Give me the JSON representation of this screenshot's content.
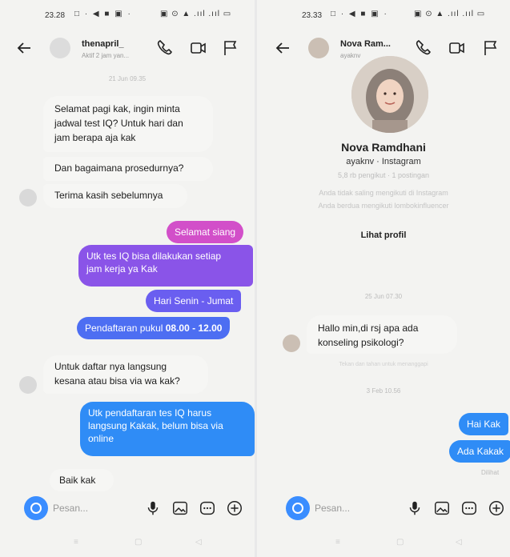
{
  "left": {
    "status": {
      "time": "23.28",
      "left_icons": "□ · ◀ ■ ▣ ·",
      "right_icons": "▣ ⊙ ▲ .ııl .ııl ▭"
    },
    "header": {
      "name": "thenapril_",
      "subtitle": "Aktif 2 jam yan..."
    },
    "timestamp_top": "21 Jun 09.35",
    "messages_in_top": [
      "Selamat pagi kak, ingin minta",
      "jadwal test IQ? Untuk hari dan",
      "jam berapa aja kak",
      "Dan bagaimana prosedurnya?",
      "Terima kasih sebelumnya"
    ],
    "messages_out": {
      "m1": "Selamat siang",
      "m2_line1": "Utk tes IQ bisa dilakukan setiap",
      "m2_line2": "jam kerja ya Kak",
      "m3": "Hari Senin - Jumat",
      "m4_prefix": "Pendaftaran pukul ",
      "m4_bold": "08.00 - 12.00",
      "m5_line1": "Utk pendaftaran tes IQ harus",
      "m5_line2": "langsung Kakak, belum bisa via",
      "m5_line3": "online"
    },
    "messages_in_mid": [
      "Untuk daftar nya langsung",
      "kesana atau bisa via wa kak?"
    ],
    "message_in_last": "Baik kak",
    "composer": {
      "placeholder": "Pesan..."
    },
    "navbar": [
      "≡",
      "▢",
      "◁"
    ]
  },
  "right": {
    "status": {
      "time": "23.33",
      "left_icons": "□ · ◀ ■ ▣ ·",
      "right_icons": "▣ ⊙ ▲ .ııl .ııl ▭"
    },
    "header": {
      "name": "Nova Ram...",
      "subtitle": "ayaknv"
    },
    "profile": {
      "name": "Nova Ramdhani",
      "handle": "ayaknv · Instagram",
      "stats": "5,8 rb pengikut · 1 postingan",
      "line1": "Anda tidak saling mengikuti di Instagram",
      "line2": "Anda berdua mengikuti lombokinfluencer",
      "view_profile": "Lihat profil"
    },
    "timestamp_1": "25 Jun 07.30",
    "message_in": [
      "Hallo min,di rsj apa ada",
      "konseling psikologi?"
    ],
    "faint_note": "Tekan dan tahan untuk menanggapi",
    "timestamp_2": "3 Feb 10.56",
    "messages_out": [
      "Hai Kak",
      "Ada Kakak"
    ],
    "seen": "Dilihat",
    "composer": {
      "placeholder": "Pesan..."
    },
    "navbar": [
      "≡",
      "▢",
      "◁"
    ]
  },
  "colors": {
    "bubble_out_top": "#e355c8",
    "bubble_out_mid": "#8a4df0",
    "bubble_out_low": "#3b6df2",
    "bubble_out_blue": "#2f8cf6",
    "accent": "#3a8dff"
  },
  "icons": [
    "back-arrow-icon",
    "phone-icon",
    "video-call-icon",
    "flag-icon",
    "camera-icon",
    "microphone-icon",
    "gallery-icon",
    "sticker-icon",
    "plus-icon"
  ]
}
